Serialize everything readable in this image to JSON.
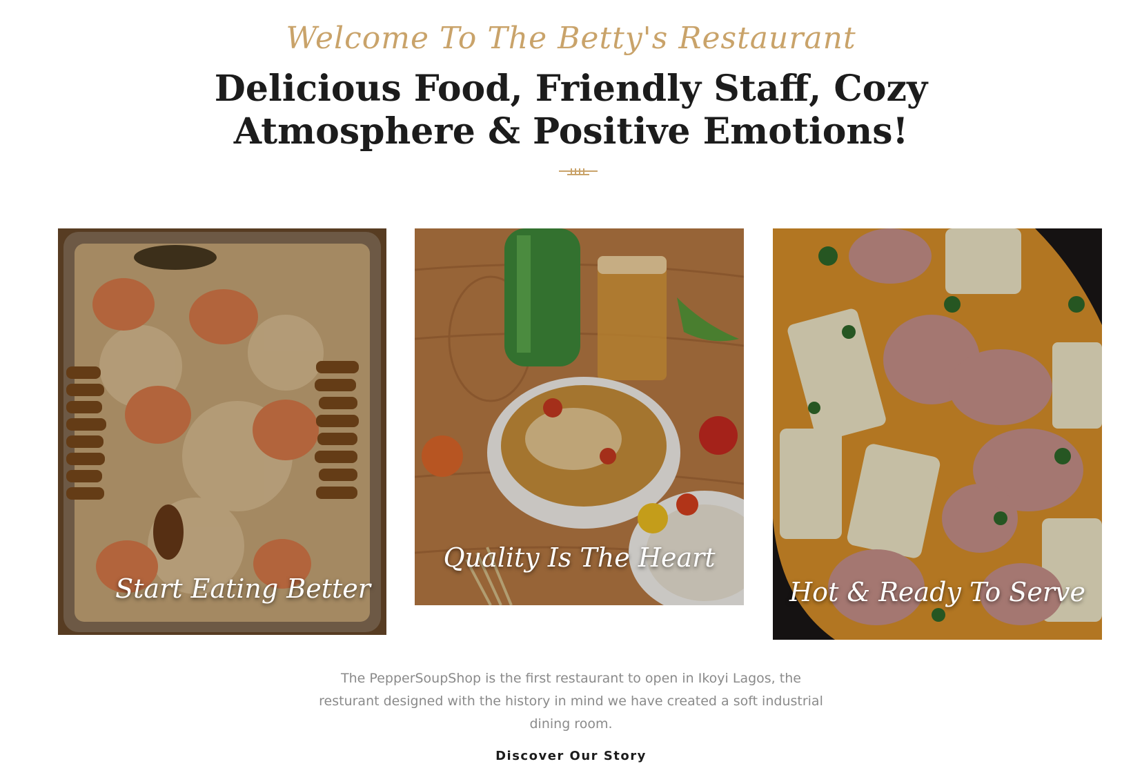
{
  "header": {
    "tagline": "Welcome To The Betty's Restaurant",
    "headline_line1": "Delicious Food, Friendly Staff, Cozy",
    "headline_line2": "Atmosphere & Positive Emotions!"
  },
  "cards": [
    {
      "caption": "Start Eating Better",
      "image": "rice-shrimp-plantain-tray"
    },
    {
      "caption": "Quality Is The Heart",
      "image": "pepper-soup-bowl-with-drinks"
    },
    {
      "caption": "Hot & Ready To Serve",
      "image": "yam-goat-meat-stew"
    }
  ],
  "about": {
    "text": "The PepperSoupShop is the first restaurant to open in Ikoyi Lagos, the resturant designed with the history in mind we have created a soft industrial dining room.",
    "link_label": "Discover Our Story"
  },
  "colors": {
    "accent": "#c9a36a",
    "heading": "#1c1c1c",
    "body_text": "#8a8a8a"
  }
}
